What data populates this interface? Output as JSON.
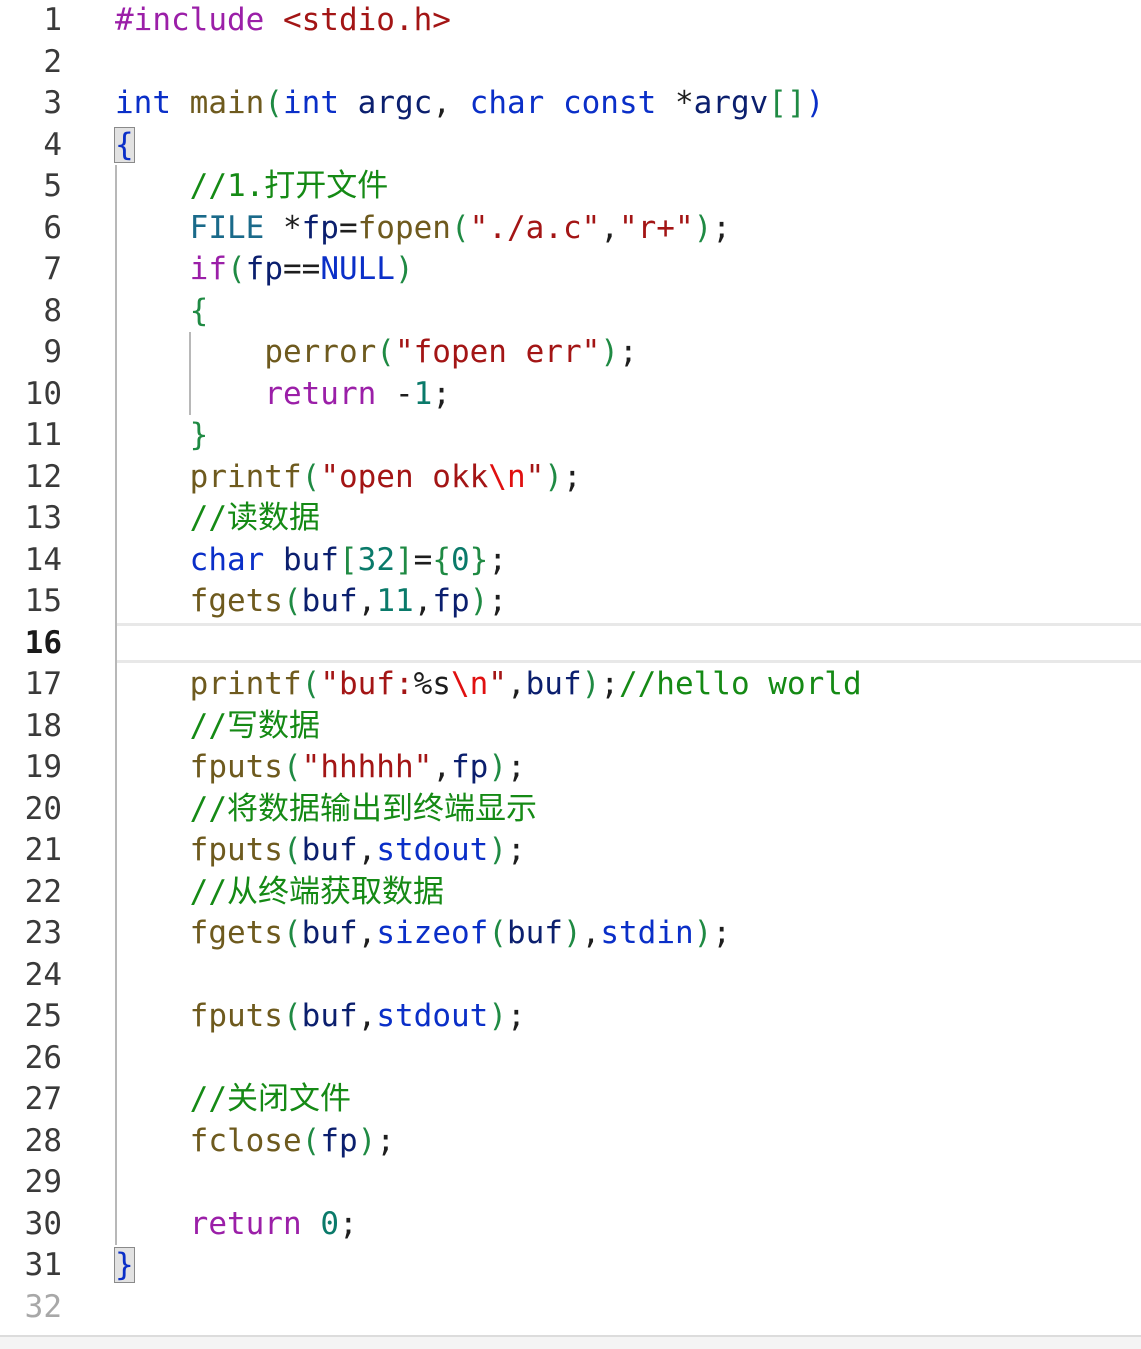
{
  "editor": {
    "current_line": 16,
    "lines": [
      {
        "n": "1",
        "tokens": [
          [
            "pp",
            "#include "
          ],
          [
            "str",
            "<stdio.h>"
          ]
        ]
      },
      {
        "n": "2",
        "tokens": []
      },
      {
        "n": "3",
        "tokens": [
          [
            "kw",
            "int"
          ],
          [
            "op",
            " "
          ],
          [
            "fn",
            "main"
          ],
          [
            "pn",
            "("
          ],
          [
            "kw",
            "int"
          ],
          [
            "op",
            " "
          ],
          [
            "id",
            "argc"
          ],
          [
            "op",
            ", "
          ],
          [
            "kw",
            "char"
          ],
          [
            "op",
            " "
          ],
          [
            "kw",
            "const"
          ],
          [
            "op",
            " *"
          ],
          [
            "id",
            "argv"
          ],
          [
            "pn",
            "[]"
          ],
          [
            "kw",
            ")"
          ]
        ]
      },
      {
        "n": "4",
        "tokens": [
          [
            "brace",
            "{"
          ]
        ]
      },
      {
        "n": "5",
        "tokens": [
          [
            "op",
            "    "
          ],
          [
            "cm",
            "//1.打开文件"
          ]
        ]
      },
      {
        "n": "6",
        "tokens": [
          [
            "op",
            "    "
          ],
          [
            "ty",
            "FILE"
          ],
          [
            "op",
            " *"
          ],
          [
            "id",
            "fp"
          ],
          [
            "op",
            "="
          ],
          [
            "fn",
            "fopen"
          ],
          [
            "pn",
            "("
          ],
          [
            "str",
            "\"./a.c\""
          ],
          [
            "op",
            ","
          ],
          [
            "str",
            "\"r+\""
          ],
          [
            "pn",
            ")"
          ],
          [
            "op",
            ";"
          ]
        ]
      },
      {
        "n": "7",
        "tokens": [
          [
            "op",
            "    "
          ],
          [
            "ctl",
            "if"
          ],
          [
            "pn",
            "("
          ],
          [
            "id",
            "fp"
          ],
          [
            "op",
            "=="
          ],
          [
            "cst",
            "NULL"
          ],
          [
            "pn",
            ")"
          ]
        ]
      },
      {
        "n": "8",
        "tokens": [
          [
            "op",
            "    "
          ],
          [
            "pn",
            "{"
          ]
        ]
      },
      {
        "n": "9",
        "tokens": [
          [
            "op",
            "        "
          ],
          [
            "fn",
            "perror"
          ],
          [
            "pn",
            "("
          ],
          [
            "str",
            "\"fopen err\""
          ],
          [
            "pn",
            ")"
          ],
          [
            "op",
            ";"
          ]
        ]
      },
      {
        "n": "10",
        "tokens": [
          [
            "op",
            "        "
          ],
          [
            "ctl",
            "return"
          ],
          [
            "op",
            " -"
          ],
          [
            "num",
            "1"
          ],
          [
            "op",
            ";"
          ]
        ]
      },
      {
        "n": "11",
        "tokens": [
          [
            "op",
            "    "
          ],
          [
            "pn",
            "}"
          ]
        ]
      },
      {
        "n": "12",
        "tokens": [
          [
            "op",
            "    "
          ],
          [
            "fn",
            "printf"
          ],
          [
            "pn",
            "("
          ],
          [
            "str",
            "\"open okk"
          ],
          [
            "esc",
            "\\n"
          ],
          [
            "str",
            "\""
          ],
          [
            "pn",
            ")"
          ],
          [
            "op",
            ";"
          ]
        ]
      },
      {
        "n": "13",
        "tokens": [
          [
            "op",
            "    "
          ],
          [
            "cm",
            "//读数据"
          ]
        ]
      },
      {
        "n": "14",
        "tokens": [
          [
            "op",
            "    "
          ],
          [
            "kw",
            "char"
          ],
          [
            "op",
            " "
          ],
          [
            "id",
            "buf"
          ],
          [
            "pn",
            "["
          ],
          [
            "num",
            "32"
          ],
          [
            "pn",
            "]"
          ],
          [
            "op",
            "="
          ],
          [
            "pn",
            "{"
          ],
          [
            "num",
            "0"
          ],
          [
            "pn",
            "}"
          ],
          [
            "op",
            ";"
          ]
        ]
      },
      {
        "n": "15",
        "tokens": [
          [
            "op",
            "    "
          ],
          [
            "fn",
            "fgets"
          ],
          [
            "pn",
            "("
          ],
          [
            "id",
            "buf"
          ],
          [
            "op",
            ","
          ],
          [
            "num",
            "11"
          ],
          [
            "op",
            ","
          ],
          [
            "id",
            "fp"
          ],
          [
            "pn",
            ")"
          ],
          [
            "op",
            ";"
          ]
        ]
      },
      {
        "n": "16",
        "tokens": []
      },
      {
        "n": "17",
        "tokens": [
          [
            "op",
            "    "
          ],
          [
            "fn",
            "printf"
          ],
          [
            "pn",
            "("
          ],
          [
            "str",
            "\"buf:"
          ],
          [
            "op",
            "%s"
          ],
          [
            "esc",
            "\\n"
          ],
          [
            "str",
            "\""
          ],
          [
            "op",
            ","
          ],
          [
            "id",
            "buf"
          ],
          [
            "pn",
            ")"
          ],
          [
            "op",
            ";"
          ],
          [
            "cm",
            "//hello world"
          ]
        ]
      },
      {
        "n": "18",
        "tokens": [
          [
            "op",
            "    "
          ],
          [
            "cm",
            "//写数据"
          ]
        ]
      },
      {
        "n": "19",
        "tokens": [
          [
            "op",
            "    "
          ],
          [
            "fn",
            "fputs"
          ],
          [
            "pn",
            "("
          ],
          [
            "str",
            "\"hhhhh\""
          ],
          [
            "op",
            ","
          ],
          [
            "id",
            "fp"
          ],
          [
            "pn",
            ")"
          ],
          [
            "op",
            ";"
          ]
        ]
      },
      {
        "n": "20",
        "tokens": [
          [
            "op",
            "    "
          ],
          [
            "cm",
            "//将数据输出到终端显示"
          ]
        ]
      },
      {
        "n": "21",
        "tokens": [
          [
            "op",
            "    "
          ],
          [
            "fn",
            "fputs"
          ],
          [
            "pn",
            "("
          ],
          [
            "id",
            "buf"
          ],
          [
            "op",
            ","
          ],
          [
            "kw",
            "stdout"
          ],
          [
            "pn",
            ")"
          ],
          [
            "op",
            ";"
          ]
        ]
      },
      {
        "n": "22",
        "tokens": [
          [
            "op",
            "    "
          ],
          [
            "cm",
            "//从终端获取数据"
          ]
        ]
      },
      {
        "n": "23",
        "tokens": [
          [
            "op",
            "    "
          ],
          [
            "fn",
            "fgets"
          ],
          [
            "pn",
            "("
          ],
          [
            "id",
            "buf"
          ],
          [
            "op",
            ","
          ],
          [
            "kw",
            "sizeof"
          ],
          [
            "pn",
            "("
          ],
          [
            "id",
            "buf"
          ],
          [
            "pn",
            ")"
          ],
          [
            "op",
            ","
          ],
          [
            "kw",
            "stdin"
          ],
          [
            "pn",
            ")"
          ],
          [
            "op",
            ";"
          ]
        ]
      },
      {
        "n": "24",
        "tokens": []
      },
      {
        "n": "25",
        "tokens": [
          [
            "op",
            "    "
          ],
          [
            "fn",
            "fputs"
          ],
          [
            "pn",
            "("
          ],
          [
            "id",
            "buf"
          ],
          [
            "op",
            ","
          ],
          [
            "kw",
            "stdout"
          ],
          [
            "pn",
            ")"
          ],
          [
            "op",
            ";"
          ]
        ]
      },
      {
        "n": "26",
        "tokens": []
      },
      {
        "n": "27",
        "tokens": [
          [
            "op",
            "    "
          ],
          [
            "cm",
            "//关闭文件"
          ]
        ]
      },
      {
        "n": "28",
        "tokens": [
          [
            "op",
            "    "
          ],
          [
            "fn",
            "fclose"
          ],
          [
            "pn",
            "("
          ],
          [
            "id",
            "fp"
          ],
          [
            "pn",
            ")"
          ],
          [
            "op",
            ";"
          ]
        ]
      },
      {
        "n": "29",
        "tokens": []
      },
      {
        "n": "30",
        "tokens": [
          [
            "op",
            "    "
          ],
          [
            "ctl",
            "return"
          ],
          [
            "op",
            " "
          ],
          [
            "num",
            "0"
          ],
          [
            "op",
            ";"
          ]
        ]
      },
      {
        "n": "31",
        "tokens": [
          [
            "brace",
            "}"
          ]
        ]
      },
      {
        "n": "32",
        "tokens": []
      }
    ]
  }
}
